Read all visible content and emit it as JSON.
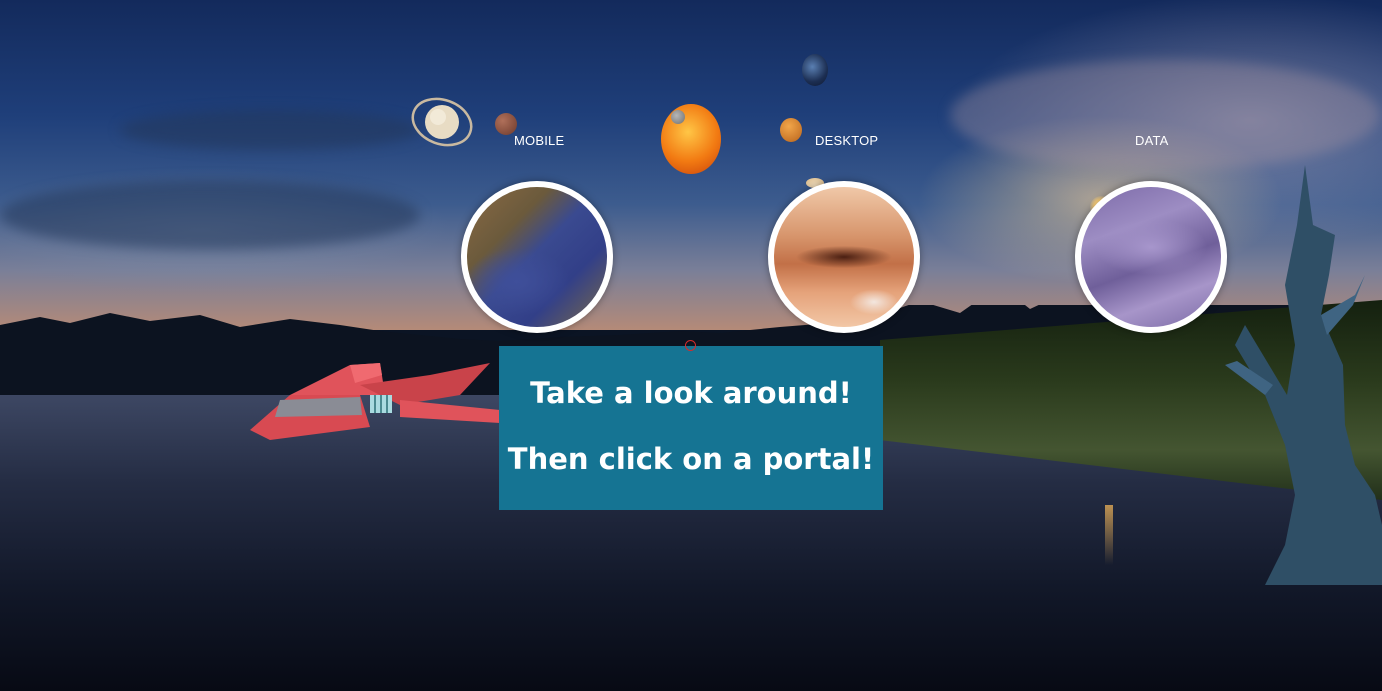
{
  "portals": [
    {
      "label": "MOBILE",
      "kind": "rocky planet texture"
    },
    {
      "label": "DESKTOP",
      "kind": "gas giant texture"
    },
    {
      "label": "DATA",
      "kind": "purple cloud texture"
    }
  ],
  "message": {
    "line1": "Take a look around!",
    "line2": "Then click on a portal!"
  },
  "colors": {
    "panel": "#157493",
    "portal_ring": "#ffffff",
    "reticle": "#d62a2a",
    "ship": "#e0535b"
  },
  "icons": [
    "saturn-icon",
    "mars-icon",
    "sun-icon",
    "venus-icon",
    "earth-icon",
    "moon-icon",
    "spaceship-icon",
    "tree-icon",
    "reticle-icon"
  ]
}
